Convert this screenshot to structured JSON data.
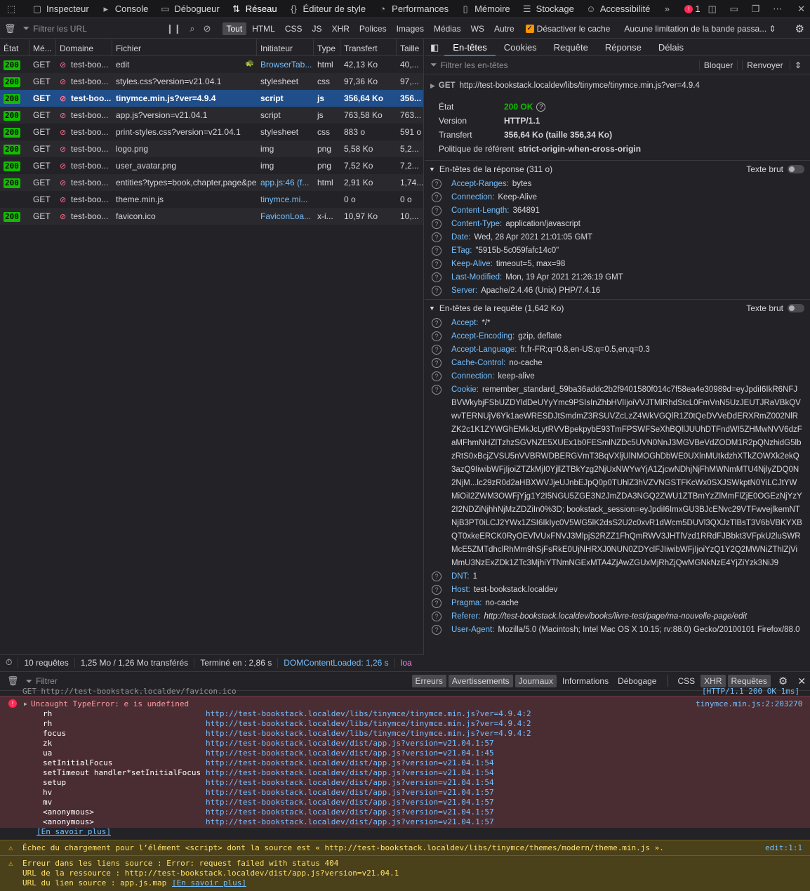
{
  "toolbar": {
    "tabs": [
      {
        "label": "Inspecteur",
        "icon": "inspector-icon"
      },
      {
        "label": "Console",
        "icon": "console-icon"
      },
      {
        "label": "Débogueur",
        "icon": "debugger-icon"
      },
      {
        "label": "Réseau",
        "icon": "network-icon"
      },
      {
        "label": "Éditeur de style",
        "icon": "style-editor-icon"
      },
      {
        "label": "Performances",
        "icon": "performance-icon"
      },
      {
        "label": "Mémoire",
        "icon": "memory-icon"
      },
      {
        "label": "Stockage",
        "icon": "storage-icon"
      },
      {
        "label": "Accessibilité",
        "icon": "accessibility-icon"
      }
    ],
    "error_count": "1"
  },
  "filterbar": {
    "filter_placeholder": "Filtrer les URL",
    "types": [
      "Tout",
      "HTML",
      "CSS",
      "JS",
      "XHR",
      "Polices",
      "Images",
      "Médias",
      "WS",
      "Autre"
    ],
    "disable_cache": "Désactiver le cache",
    "throttle": "Aucune limitation de la bande passa..."
  },
  "table": {
    "columns": [
      "État",
      "Mé...",
      "Domaine",
      "Fichier",
      "Initiateur",
      "Type",
      "Transfert",
      "Taille"
    ],
    "rows": [
      {
        "status": "200",
        "method": "GET",
        "domain": "test-boo...",
        "file": "edit",
        "initiator": "BrowserTab...",
        "type": "html",
        "transfer": "42,13 Ko",
        "size": "40,..."
      },
      {
        "status": "200",
        "method": "GET",
        "domain": "test-boo...",
        "file": "styles.css?version=v21.04.1",
        "initiator": "stylesheet",
        "type": "css",
        "transfer": "97,36 Ko",
        "size": "97,..."
      },
      {
        "status": "200",
        "method": "GET",
        "domain": "test-boo...",
        "file": "tinymce.min.js?ver=4.9.4",
        "initiator": "script",
        "type": "js",
        "transfer": "356,64 Ko",
        "size": "356..."
      },
      {
        "status": "200",
        "method": "GET",
        "domain": "test-boo...",
        "file": "app.js?version=v21.04.1",
        "initiator": "script",
        "type": "js",
        "transfer": "763,58 Ko",
        "size": "763..."
      },
      {
        "status": "200",
        "method": "GET",
        "domain": "test-boo...",
        "file": "print-styles.css?version=v21.04.1",
        "initiator": "stylesheet",
        "type": "css",
        "transfer": "883 o",
        "size": "591 o"
      },
      {
        "status": "200",
        "method": "GET",
        "domain": "test-boo...",
        "file": "logo.png",
        "initiator": "img",
        "type": "png",
        "transfer": "5,58 Ko",
        "size": "5,2..."
      },
      {
        "status": "200",
        "method": "GET",
        "domain": "test-boo...",
        "file": "user_avatar.png",
        "initiator": "img",
        "type": "png",
        "transfer": "7,52 Ko",
        "size": "7,2..."
      },
      {
        "status": "200",
        "method": "GET",
        "domain": "test-boo...",
        "file": "entities?types=book,chapter,page&pe",
        "initiator": "app.js:46 (f...",
        "type": "html",
        "transfer": "2,91 Ko",
        "size": "1,74..."
      },
      {
        "status": "",
        "method": "GET",
        "domain": "test-boo...",
        "file": "theme.min.js",
        "initiator": "tinymce.mi...",
        "type": "",
        "transfer": "0 o",
        "size": "0 o"
      },
      {
        "status": "200",
        "method": "GET",
        "domain": "test-boo...",
        "file": "favicon.ico",
        "initiator": "FaviconLoa...",
        "type": "x-i...",
        "transfer": "10,97 Ko",
        "size": "10,..."
      }
    ]
  },
  "statusbar": {
    "requests": "10 requêtes",
    "transferred": "1,25 Mo / 1,26 Mo transférés",
    "finished": "Terminé en : 2,86 s",
    "dcl": "DOMContentLoaded: 1,26 s",
    "load": "loa"
  },
  "panel": {
    "tabs": [
      "En-têtes",
      "Cookies",
      "Requête",
      "Réponse",
      "Délais"
    ],
    "filter_placeholder": "Filtrer les en-têtes",
    "block": "Bloquer",
    "resend": "Renvoyer",
    "request_method": "GET",
    "request_url": "http://test-bookstack.localdev/libs/tinymce/tinymce.min.js?ver=4.9.4",
    "summary": [
      {
        "k": "État",
        "v": "200 OK"
      },
      {
        "k": "Version",
        "v": "HTTP/1.1"
      },
      {
        "k": "Transfert",
        "v": "356,64 Ko (taille 356,34 Ko)"
      },
      {
        "k": "Politique de référent",
        "v": "strict-origin-when-cross-origin"
      }
    ],
    "response_title": "En-têtes de la réponse (311 o)",
    "raw_label": "Texte brut",
    "response_headers": [
      {
        "k": "Accept-Ranges:",
        "v": "bytes"
      },
      {
        "k": "Connection:",
        "v": "Keep-Alive"
      },
      {
        "k": "Content-Length:",
        "v": "364891"
      },
      {
        "k": "Content-Type:",
        "v": "application/javascript"
      },
      {
        "k": "Date:",
        "v": "Wed, 28 Apr 2021 21:01:05 GMT"
      },
      {
        "k": "ETag:",
        "v": "\"5915b-5c059fafc14c0\""
      },
      {
        "k": "Keep-Alive:",
        "v": "timeout=5, max=98"
      },
      {
        "k": "Last-Modified:",
        "v": "Mon, 19 Apr 2021 21:26:19 GMT"
      },
      {
        "k": "Server:",
        "v": "Apache/2.4.46 (Unix) PHP/7.4.16"
      }
    ],
    "request_title": "En-têtes de la requête (1,642 Ko)",
    "request_headers": [
      {
        "k": "Accept:",
        "v": "*/*"
      },
      {
        "k": "Accept-Encoding:",
        "v": "gzip, deflate"
      },
      {
        "k": "Accept-Language:",
        "v": "fr,fr-FR;q=0.8,en-US;q=0.5,en;q=0.3"
      },
      {
        "k": "Cache-Control:",
        "v": "no-cache"
      },
      {
        "k": "Connection:",
        "v": "keep-alive"
      },
      {
        "k": "Cookie:",
        "v": "remember_standard_59ba36addc2b2f9401580f014c7f58ea4e30989d=eyJpdiI6IkR6NFJBVWkybjFSbUZDYldDeUYyYmc9PSIsInZhbHVlIjoiVVJTMlRhdStcL0FmVnN5UzJEUTJRaVBkQVwvTERNUjV6Yk1aeWRESDJtSmdmZ3RSUVZcLzZ4WkVGQlR1Z0tQeDVVeDdERXRmZ002NlRZK2c1K1ZYWGhEMkJcLytRVVBpekpybE93TmFPSWFSeXhBQllJUUhDTFndWI5ZHMwNVV6dzFaMFhmNHZlTzhzSGVNZE5XUEx1b0FESmlNZDc5UVN0NnJ3MGVBeVdZODM1R2pQNzhidG5lbzRtS0xBcjZVSU5nVVBRWDBERGVmT3BqVXljUlNMOGhDbWE0UXlnMUtkdzhXTkZOWXk2ekQ3azQ9IiwibWFjIjoiZTZkMjI0YjllZTBkYzg2NjUxNWYwYjA1ZjcwNDhjNjFhMWNmMTU4NjlyZDQ0N2NjM...lc29zR0d2aHBXWVJjeUJnbEJpQ0p0TUhlZ3hVZVNGSTFKcWx0SXJSWkptN0YiLCJtYWMiOiI2ZWM3OWFjYjg1Y2I5NGU5ZGE3N2JmZDA3NGQ2ZWU1ZTBmYzZlMmFlZjE0OGEzNjYzY2I2NDZiNjhhNjMzZDZiIn0%3D; bookstack_session=eyJpdiI6ImxGU3BJcENvc29VTFwvejlkemNTNjB3PT0iLCJ2YWx1ZSI6IkIyc0V5WG5lK2dsS2U2c0xvR1dWcm5DUVl3QXJzTlBsT3V6bVBKYXBQT0xkeERCK0RyOEVlVUxFNVJ3MlpjS2RZZ1FhQmRWV3JHTlVzd1RRdFJBbkt3VFpkU2luSWRMcE5ZMTdhclRhMm9hSjFsRkE0UjNHRXJ0NUN0ZDYclFJIiwibWFjIjoiYzQ1Y2Q2MWNiZThlZjViMmU3NzExZDk1ZTc3MjhiYTNmNGExMTA4ZjAwZGUxMjRhZjQwMGNkNzE4YjZiYzk3NiJ9"
      },
      {
        "k": "DNT:",
        "v": "1"
      },
      {
        "k": "Host:",
        "v": "test-bookstack.localdev"
      },
      {
        "k": "Pragma:",
        "v": "no-cache"
      },
      {
        "k": "Referer:",
        "v": "http://test-bookstack.localdev/books/livre-test/page/ma-nouvelle-page/edit"
      },
      {
        "k": "User-Agent:",
        "v": "Mozilla/5.0 (Macintosh; Intel Mac OS X 10.15; rv:88.0) Gecko/20100101 Firefox/88.0"
      }
    ]
  },
  "consolebar": {
    "filter_placeholder": "Filtrer",
    "levels": [
      "Erreurs",
      "Avertissements",
      "Journaux",
      "Informations",
      "Débogage"
    ],
    "kinds": [
      "CSS",
      "XHR",
      "Requêtes"
    ]
  },
  "console": {
    "clipped_line": "GET http://test-bookstack.localdev/favicon.ico",
    "clipped_right": "[HTTP/1.1 200 OK 1ms]",
    "error_title": "Uncaught TypeError: e is undefined",
    "error_source": "tinymce.min.js:2:203270",
    "stack": [
      {
        "fn": "rh",
        "src": "http://test-bookstack.localdev/libs/tinymce/tinymce.min.js?ver=4.9.4:2"
      },
      {
        "fn": "rh",
        "src": "http://test-bookstack.localdev/libs/tinymce/tinymce.min.js?ver=4.9.4:2"
      },
      {
        "fn": "focus",
        "src": "http://test-bookstack.localdev/libs/tinymce/tinymce.min.js?ver=4.9.4:2"
      },
      {
        "fn": "zk",
        "src": "http://test-bookstack.localdev/dist/app.js?version=v21.04.1:57"
      },
      {
        "fn": "ua",
        "src": "http://test-bookstack.localdev/dist/app.js?version=v21.04.1:45"
      },
      {
        "fn": "setInitialFocus",
        "src": "http://test-bookstack.localdev/dist/app.js?version=v21.04.1:54"
      },
      {
        "fn": "setTimeout handler*setInitialFocus",
        "src": "http://test-bookstack.localdev/dist/app.js?version=v21.04.1:54"
      },
      {
        "fn": "setup",
        "src": "http://test-bookstack.localdev/dist/app.js?version=v21.04.1:54"
      },
      {
        "fn": "hv",
        "src": "http://test-bookstack.localdev/dist/app.js?version=v21.04.1:57"
      },
      {
        "fn": "mv",
        "src": "http://test-bookstack.localdev/dist/app.js?version=v21.04.1:57"
      },
      {
        "fn": "<anonymous>",
        "src": "http://test-bookstack.localdev/dist/app.js?version=v21.04.1:57"
      },
      {
        "fn": "<anonymous>",
        "src": "http://test-bookstack.localdev/dist/app.js?version=v21.04.1:57"
      }
    ],
    "learn_more": "[En savoir plus]",
    "warn1": "Échec du chargement pour l’élément <script> dont la source est « http://test-bookstack.localdev/libs/tinymce/themes/modern/theme.min.js ».",
    "warn1_src": "edit:1:1",
    "warn2_l1": "Erreur dans les liens source : Error: request failed with status 404",
    "warn2_l2": "URL de la ressource : http://test-bookstack.localdev/dist/app.js?version=v21.04.1",
    "warn2_l3": "URL du lien source : app.js.map",
    "warn2_more": "[En savoir plus]"
  },
  "colors": {
    "accent": "#0a84ff",
    "selected_row": "#204e8a",
    "ok": "#12bc00",
    "error_bg": "#4a2d33",
    "warn_bg": "#4a4019",
    "link": "#75bfff"
  }
}
